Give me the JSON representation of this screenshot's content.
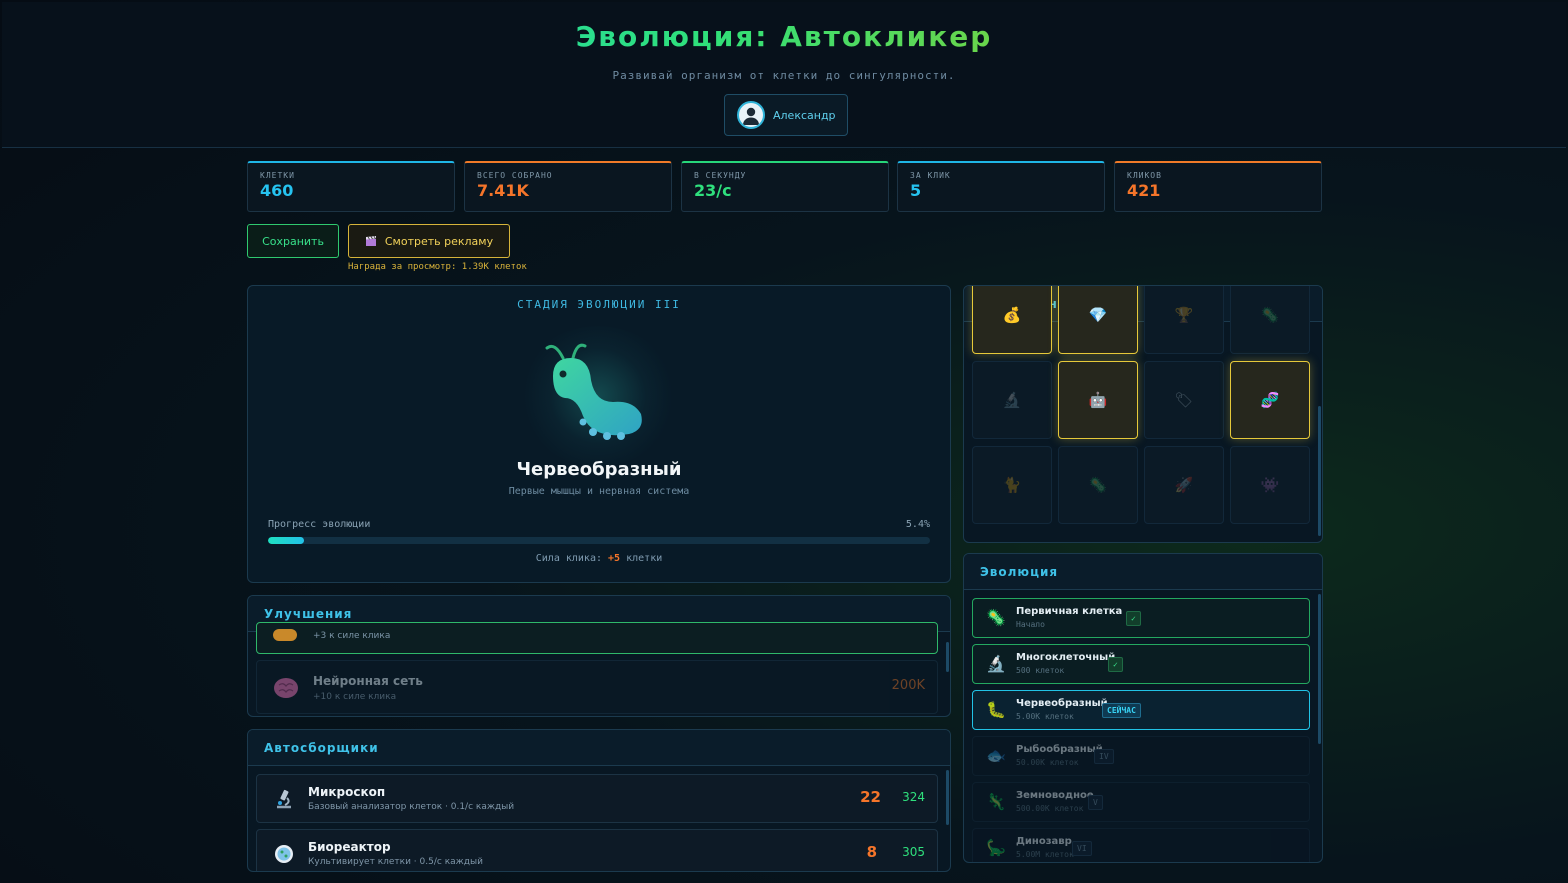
{
  "header": {
    "title": "Эволюция: Автокликер",
    "subtitle": "Развивай организм от клетки до сингулярности.",
    "user_name": "Александр"
  },
  "stats": [
    {
      "label": "КЛЕТКИ",
      "value": "460",
      "color": "#26c3f0"
    },
    {
      "label": "ВСЕГО СОБРАНО",
      "value": "7.41K",
      "color": "#f5752a"
    },
    {
      "label": "В СЕКУНДУ",
      "value": "23/с",
      "color": "#2fe07d"
    },
    {
      "label": "ЗА КЛИК",
      "value": "5",
      "color": "#26c3f0"
    },
    {
      "label": "КЛИКОВ",
      "value": "421",
      "color": "#f5752a"
    }
  ],
  "actions": {
    "save_label": "Сохранить",
    "ad_label": "Смотреть рекламу",
    "ad_icon": "clapperboard-icon",
    "ad_reward": "Награда за просмотр: 1.39K клеток"
  },
  "stage": {
    "title": "СТАДИЯ ЭВОЛЮЦИИ III",
    "name": "Червеобразный",
    "description": "Первые мышцы и нервная система",
    "progress_label": "Прогресс эволюции",
    "progress_text": "5.4%",
    "progress": 0.054,
    "click_power_prefix": "Сила клика:",
    "click_power_value": "+5",
    "click_power_suffix": "клетки"
  },
  "achievements": {
    "title": "Достижения",
    "items": [
      {
        "icon": "moneybag-icon",
        "glyph": "💰",
        "unlocked": true
      },
      {
        "icon": "diamond-icon",
        "glyph": "💎",
        "unlocked": true
      },
      {
        "icon": "trophy-icon",
        "glyph": "🏆",
        "unlocked": false
      },
      {
        "icon": "virus-icon",
        "glyph": "🦠",
        "unlocked": false
      },
      {
        "icon": "microscope-icon",
        "glyph": "🔬",
        "unlocked": false
      },
      {
        "icon": "robot-icon",
        "glyph": "🤖",
        "unlocked": true
      },
      {
        "icon": "tag-icon",
        "glyph": "🏷",
        "unlocked": false
      },
      {
        "icon": "dna-icon",
        "glyph": "🧬",
        "unlocked": true
      },
      {
        "icon": "cat-icon",
        "glyph": "🐈",
        "unlocked": false
      },
      {
        "icon": "bug-icon",
        "glyph": "🦠",
        "unlocked": false
      },
      {
        "icon": "rocket-icon",
        "glyph": "🚀",
        "unlocked": false
      },
      {
        "icon": "astronaut-icon",
        "glyph": "👾",
        "unlocked": false
      }
    ]
  },
  "upgrades": {
    "title": "Улучшения",
    "items": [
      {
        "name": "",
        "desc": "+3 к силе клика",
        "cost": ""
      },
      {
        "name": "Нейронная сеть",
        "desc": "+10 к силе клика",
        "cost": "200K",
        "icon": "brain-icon"
      }
    ]
  },
  "autoclickers": {
    "title": "Автосборщики",
    "items": [
      {
        "name": "Микроскоп",
        "desc": "Базовый анализатор клеток · 0.1/с каждый",
        "owned": "22",
        "cost": "324",
        "icon": "microscope-icon"
      },
      {
        "name": "Биореактор",
        "desc": "Культивирует клетки · 0.5/с каждый",
        "owned": "8",
        "cost": "305",
        "icon": "bioreactor-icon"
      }
    ]
  },
  "evolution": {
    "title": "Эволюция",
    "items": [
      {
        "name": "Первичная клетка",
        "sub": "Начало",
        "badge": "✓",
        "state": "done",
        "icon": "cell-icon"
      },
      {
        "name": "Многоклеточный",
        "sub": "500 клеток",
        "badge": "✓",
        "state": "done",
        "icon": "microscope-icon"
      },
      {
        "name": "Червеобразный",
        "sub": "5.00K клеток",
        "badge": "СЕЙЧАС",
        "state": "cur",
        "icon": "worm-icon"
      },
      {
        "name": "Рыбообразный",
        "sub": "50.00K клеток",
        "badge": "IV",
        "state": "locked",
        "icon": "fish-icon"
      },
      {
        "name": "Земноводное",
        "sub": "500.00K клеток",
        "badge": "V",
        "state": "locked",
        "icon": "lizard-icon"
      },
      {
        "name": "Динозавр",
        "sub": "5.00M клеток",
        "badge": "VI",
        "state": "locked",
        "icon": "dinosaur-icon"
      }
    ]
  }
}
